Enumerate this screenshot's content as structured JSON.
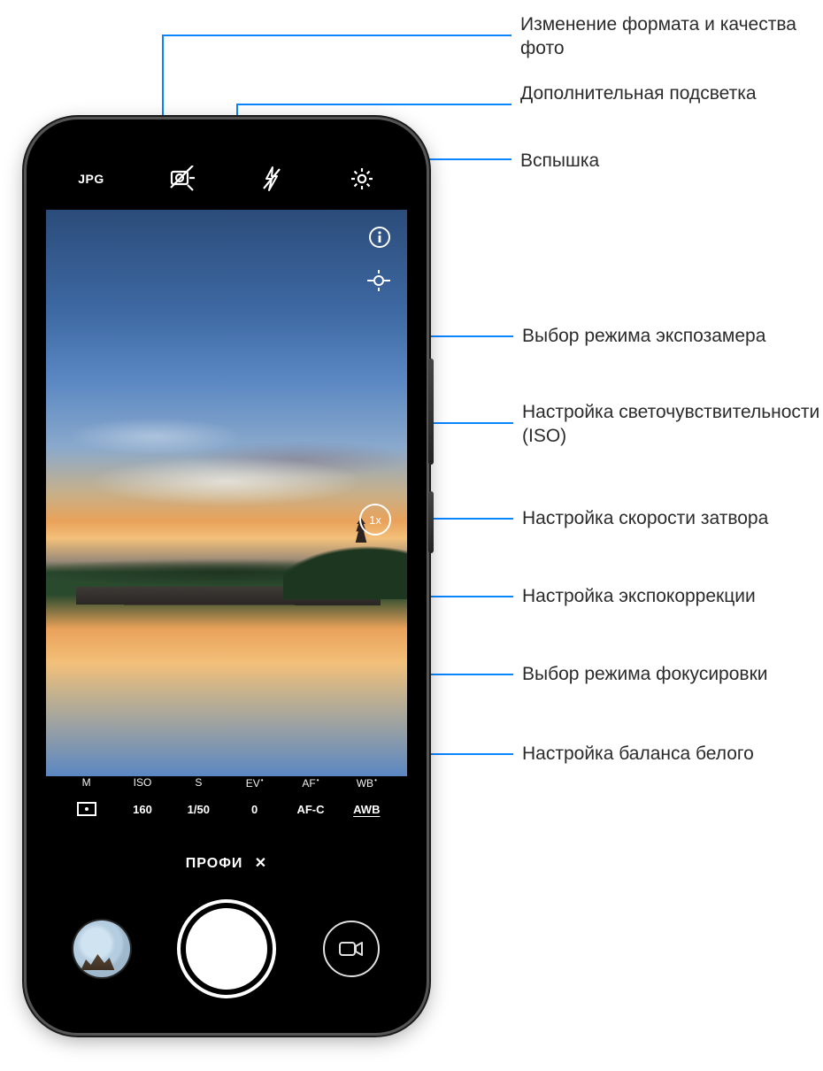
{
  "annotations": {
    "format": "Изменение формата и качества фото",
    "light": "Дополнительная подсветка",
    "flash": "Вспышка",
    "meter": "Выбор режима экспозамера",
    "iso": "Настройка светочувствительности (ISO)",
    "shutter": "Настройка скорости затвора",
    "ev": "Настройка экспокоррекции",
    "focus": "Выбор режима фокусировки",
    "wb": "Настройка баланса белого"
  },
  "topbar": {
    "format_label": "JPG"
  },
  "params": {
    "m": {
      "label": "M",
      "value_icon": "metering"
    },
    "iso": {
      "label": "ISO",
      "value": "160"
    },
    "s": {
      "label": "S",
      "value": "1/50"
    },
    "ev": {
      "label": "EV",
      "value": "0",
      "dot": true
    },
    "af": {
      "label": "AF",
      "value": "AF-C",
      "dot": true
    },
    "wb": {
      "label": "WB",
      "value": "AWB",
      "dot": true
    }
  },
  "mode": {
    "label": "ПРОФИ",
    "close": "✕"
  },
  "vf": {
    "zoom": "1x"
  },
  "colors": {
    "accent": "#0b84ff"
  }
}
